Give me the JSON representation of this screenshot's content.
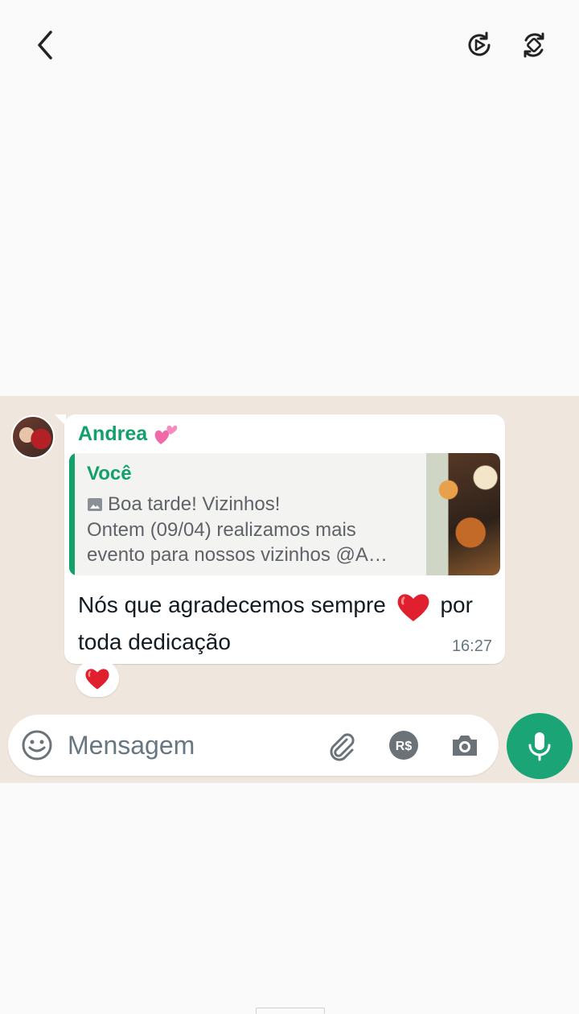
{
  "header": {
    "back_icon": "chevron-left-icon",
    "replay_icon": "replay-play-icon",
    "rotate_icon": "rotate-icon"
  },
  "message": {
    "sender": "Andrea",
    "sender_emoji": "two-hearts-emoji",
    "quote": {
      "author": "Você",
      "image_icon": "image-icon",
      "line1": "Boa tarde! Vizinhos!",
      "line2": "Ontem (09/04) realizamos mais",
      "line3": "evento para nossos vizinhos @A…"
    },
    "text_part1": "Nós que agradecemos sempre",
    "text_part2": "por toda dedicação",
    "time": "16:27",
    "reaction": "red-heart-emoji"
  },
  "composer": {
    "placeholder": "Mensagem",
    "pay_label": "R$"
  },
  "colors": {
    "accent": "#12a06b",
    "mic": "#1ba476",
    "chat_bg": "#efe7de",
    "heart": "#e0202e"
  }
}
